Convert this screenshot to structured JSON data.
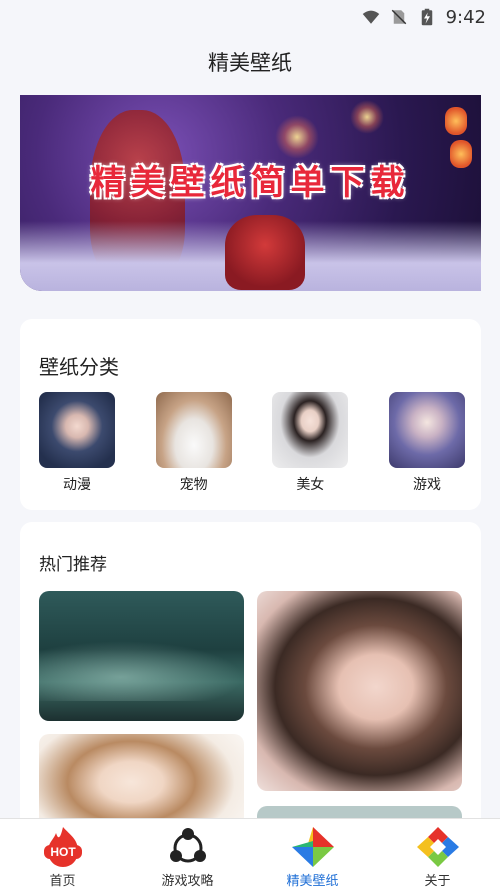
{
  "status_bar": {
    "time": "9:42",
    "icons": [
      "wifi-icon",
      "no-sim-icon",
      "battery-charging-icon"
    ]
  },
  "header": {
    "title": "精美壁纸"
  },
  "banner": {
    "title": "精美壁纸简单下载"
  },
  "categories": {
    "title": "壁纸分类",
    "items": [
      {
        "label": "动漫",
        "icon": "anime-thumbnail"
      },
      {
        "label": "宠物",
        "icon": "pet-thumbnail"
      },
      {
        "label": "美女",
        "icon": "beauty-thumbnail"
      },
      {
        "label": "游戏",
        "icon": "game-thumbnail"
      }
    ]
  },
  "hot": {
    "title": "热门推荐"
  },
  "bottom_nav": {
    "items": [
      {
        "label": "首页",
        "icon": "hot-fire-icon",
        "active": false
      },
      {
        "label": "游戏攻略",
        "icon": "share-nodes-icon",
        "active": false
      },
      {
        "label": "精美壁纸",
        "icon": "colorful-star-icon",
        "active": true
      },
      {
        "label": "关于",
        "icon": "colorful-diamond-icon",
        "active": false
      }
    ],
    "hot_badge": "HOT"
  },
  "colors": {
    "active_nav": "#1f6fd6",
    "banner_title": "#e8283a",
    "hot_icon": "#e6322a"
  }
}
